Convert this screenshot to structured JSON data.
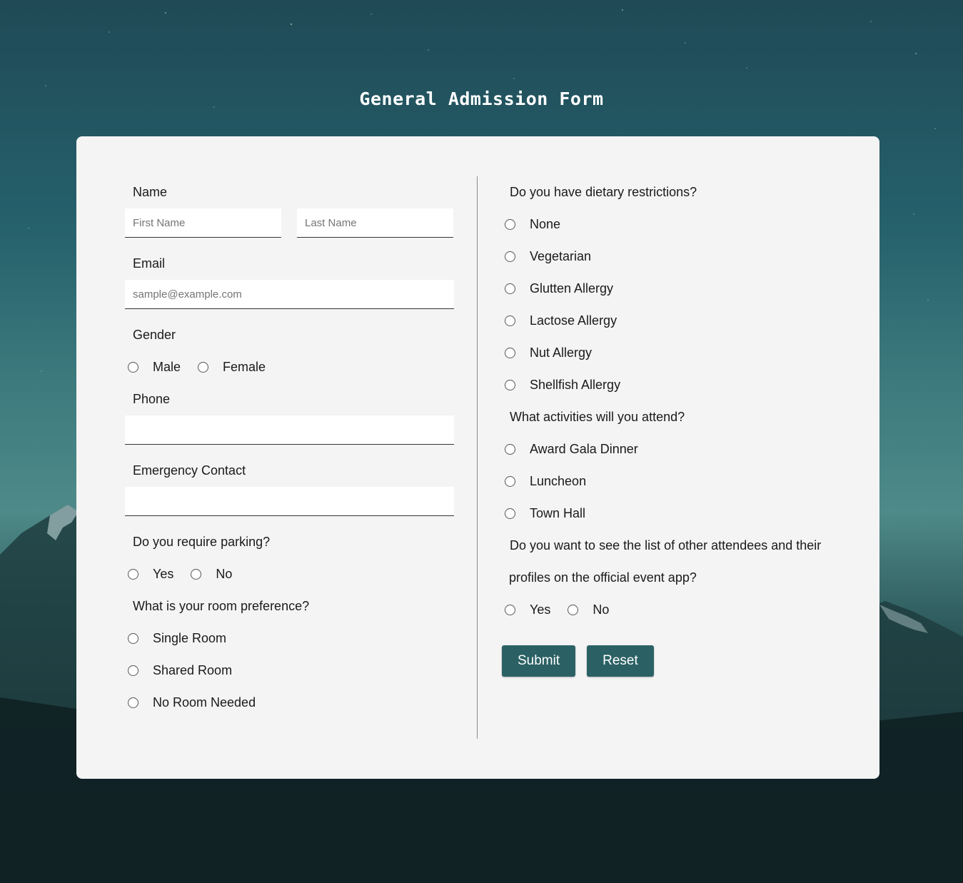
{
  "page": {
    "title": "General Admission Form"
  },
  "theme": {
    "accent": "#2b6164",
    "card_background": "#f4f4f4"
  },
  "left": {
    "name": {
      "label": "Name",
      "first_placeholder": "First Name",
      "last_placeholder": "Last Name",
      "first_value": "",
      "last_value": ""
    },
    "email": {
      "label": "Email",
      "placeholder": "sample@example.com",
      "value": ""
    },
    "gender": {
      "label": "Gender",
      "options": [
        "Male",
        "Female"
      ]
    },
    "phone": {
      "label": "Phone",
      "value": ""
    },
    "emergency": {
      "label": "Emergency Contact",
      "value": ""
    },
    "parking": {
      "label": "Do you require parking?",
      "options": [
        "Yes",
        "No"
      ]
    },
    "room": {
      "label": "What is your room preference?",
      "options": [
        "Single Room",
        "Shared Room",
        "No Room Needed"
      ]
    }
  },
  "right": {
    "dietary": {
      "label": "Do you have dietary restrictions?",
      "options": [
        "None",
        "Vegetarian",
        "Glutten Allergy",
        "Lactose Allergy",
        "Nut Allergy",
        "Shellfish Allergy"
      ]
    },
    "activities": {
      "label": "What activities will you attend?",
      "options": [
        "Award Gala Dinner",
        "Luncheon",
        "Town Hall"
      ]
    },
    "attendees": {
      "label_line1": "Do you want to see the list of other attendees and their",
      "label_line2": "profiles on the official event app?",
      "options": [
        "Yes",
        "No"
      ]
    },
    "buttons": {
      "submit": "Submit",
      "reset": "Reset"
    }
  }
}
